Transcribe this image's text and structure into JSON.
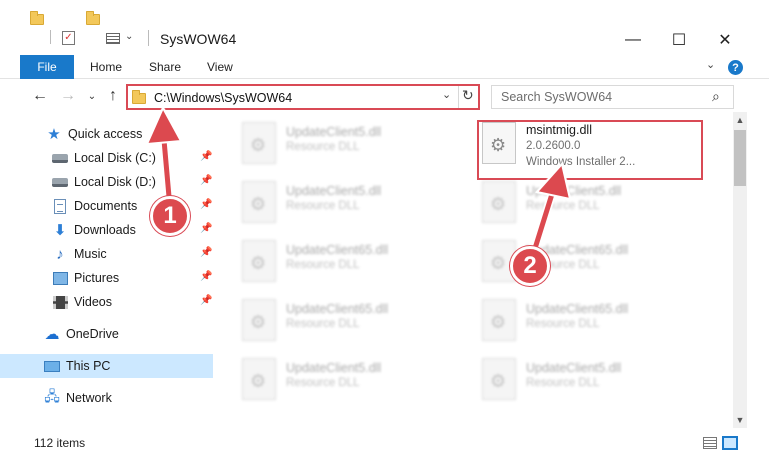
{
  "window": {
    "title": "SysWOW64",
    "minimize": "—",
    "maximize": "☐",
    "close": "✕"
  },
  "ribbon": {
    "file": "File",
    "tabs": [
      "Home",
      "Share",
      "View"
    ],
    "help": "?",
    "collapse": "⌄"
  },
  "nav": {
    "back": "←",
    "forward": "→",
    "recent": "⌄",
    "up": "↑",
    "address": "C:\\Windows\\SysWOW64",
    "address_drop": "⌄",
    "refresh": "↻"
  },
  "search": {
    "placeholder": "Search SysWOW64",
    "icon": "⌕"
  },
  "sidebar": {
    "items": [
      {
        "label": "Quick access",
        "icon": "star-icon"
      },
      {
        "label": "Local Disk (C:)",
        "icon": "disk-icon",
        "pinned": true
      },
      {
        "label": "Local Disk (D:)",
        "icon": "disk-icon",
        "pinned": true
      },
      {
        "label": "Documents",
        "icon": "document-icon",
        "pinned": true
      },
      {
        "label": "Downloads",
        "icon": "download-icon",
        "pinned": true
      },
      {
        "label": "Music",
        "icon": "music-icon",
        "pinned": true
      },
      {
        "label": "Pictures",
        "icon": "pictures-icon",
        "pinned": true
      },
      {
        "label": "Videos",
        "icon": "videos-icon",
        "pinned": true
      },
      {
        "label": "OneDrive",
        "icon": "cloud-icon"
      },
      {
        "label": "This PC",
        "icon": "pc-icon",
        "selected": true
      },
      {
        "label": "Network",
        "icon": "network-icon"
      }
    ]
  },
  "files": {
    "left": [
      {
        "name": "UpdateClient5.dll",
        "type": "Resource DLL"
      },
      {
        "name": "UpdateClient5.dll",
        "type": "Resource DLL"
      },
      {
        "name": "UpdateClient65.dll",
        "type": "Resource DLL"
      },
      {
        "name": "UpdateClient65.dll",
        "type": "Resource DLL"
      },
      {
        "name": "UpdateClient5.dll",
        "type": "Resource DLL"
      }
    ],
    "right": [
      {
        "name": "msintmig.dll",
        "version": "2.0.2600.0",
        "desc": "Windows Installer 2..."
      },
      {
        "name": "UpdateClient5.dll",
        "type": "Resource DLL"
      },
      {
        "name": "UpdateClient65.dll",
        "type": "Resource DLL"
      },
      {
        "name": "UpdateClient65.dll",
        "type": "Resource DLL"
      },
      {
        "name": "UpdateClient5.dll",
        "type": "Resource DLL"
      }
    ]
  },
  "status": {
    "count": "112 items"
  },
  "annotations": {
    "step1": "1",
    "step2": "2",
    "color": "#d94a55"
  }
}
